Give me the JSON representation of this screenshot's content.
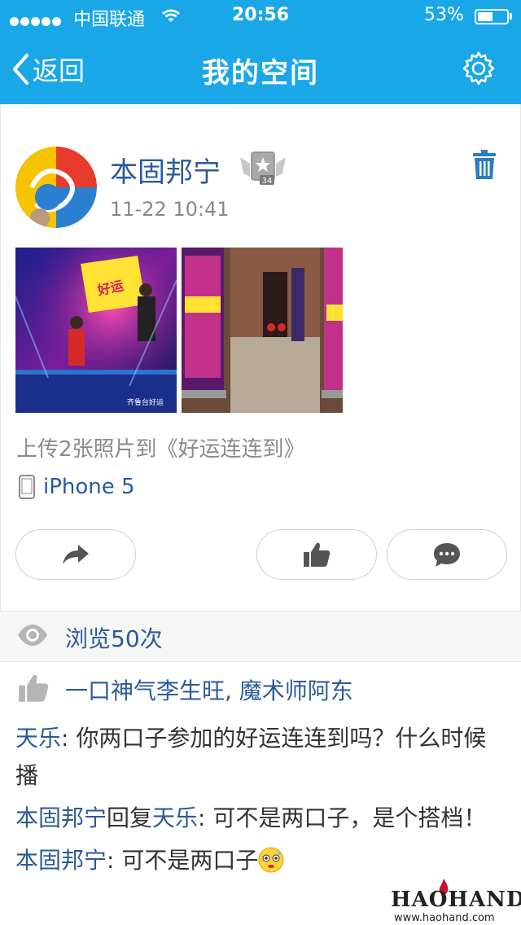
{
  "status_bar": {
    "carrier": "中国联通",
    "time": "20:56",
    "battery_pct": "53%",
    "battery_level": 0.53
  },
  "nav": {
    "back_label": "返回",
    "title": "我的空间",
    "settings_icon": "gear-icon"
  },
  "post": {
    "author": "本固邦宁",
    "level_badge": "34",
    "timestamp": "11-22 10:41",
    "photos": [
      {
        "watermark": "齐鲁台好运"
      },
      {
        "watermark": ""
      }
    ],
    "caption": "上传2张照片到《好运连连到》",
    "device": "iPhone 5",
    "actions": {
      "share_icon": "share-arrow-icon",
      "like_icon": "thumbs-up-icon",
      "comment_icon": "speech-bubble-icon"
    }
  },
  "stats": {
    "views_label": "浏览50次",
    "likers": "一口神气李生旺, 魔术师阿东"
  },
  "comments": [
    {
      "author": "天乐",
      "reply_to": "",
      "text": ": 你两口子参加的好运连连到吗？什么时候播"
    },
    {
      "author": "本固邦宁",
      "reply_word": "回复",
      "reply_to": "天乐",
      "text": ": 可不是两口子，是个搭档！"
    },
    {
      "author": "本固邦宁",
      "reply_to": "",
      "text": ": 可不是两口子",
      "emoji": "embarrassed-face-emoji"
    }
  ],
  "watermark": {
    "logo": "HAOHAND",
    "url": "www.haohand.com"
  },
  "colors": {
    "nav_blue": "#1aa7e8",
    "link_blue": "#2b5a9a",
    "gray_text": "#8a8a8a"
  }
}
